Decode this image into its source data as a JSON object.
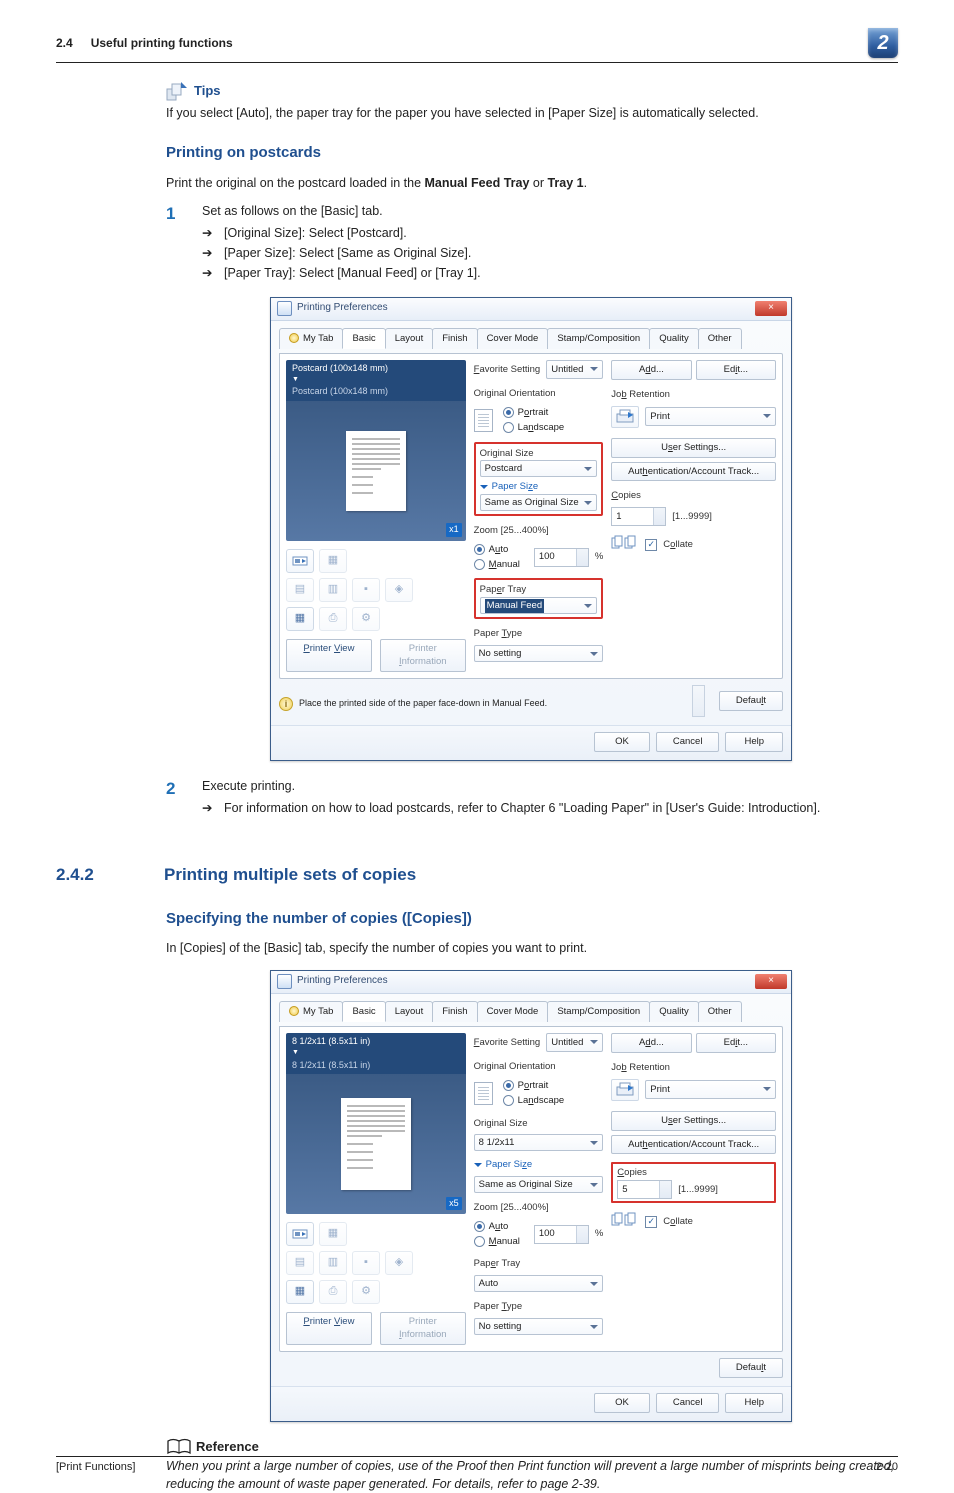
{
  "header": {
    "section": "2.4",
    "title": "Useful printing functions",
    "chapter": "2"
  },
  "tips": {
    "label": "Tips",
    "body": "If you select [Auto], the paper tray for the paper you have selected in [Paper Size] is automatically selected."
  },
  "postcards": {
    "heading": "Printing on postcards",
    "intro_pre": "Print the original on the postcard loaded in the ",
    "intro_b1": "Manual Feed Tray",
    "intro_mid": " or ",
    "intro_b2": "Tray 1",
    "intro_post": ".",
    "step1": {
      "num": "1",
      "text": "Set as follows on the [Basic] tab.",
      "bullets": [
        "[Original Size]: Select [Postcard].",
        "[Paper Size]: Select [Same as Original Size].",
        "[Paper Tray]: Select [Manual Feed] or [Tray 1]."
      ]
    },
    "step2": {
      "num": "2",
      "text": "Execute printing.",
      "bullets": [
        "For information on how to load postcards, refer to Chapter 6 \"Loading Paper\" in [User's Guide: Introduction]."
      ]
    }
  },
  "section242": {
    "num": "2.4.2",
    "title": "Printing multiple sets of copies",
    "sub": "Specifying the number of copies ([Copies])",
    "intro": "In [Copies] of the [Basic] tab, specify the number of copies you want to print."
  },
  "reference": {
    "label": "Reference",
    "body": "When you print a large number of copies, use of the Proof then Print function will prevent a large number of misprints being created, reducing the amount of waste paper generated. For details, refer to page 2-39."
  },
  "dialog": {
    "title": "Printing Preferences",
    "close": "×",
    "tabs": {
      "mytab": "My Tab",
      "basic": "Basic",
      "layout": "Layout",
      "finish": "Finish",
      "cover": "Cover Mode",
      "stamp": "Stamp/Composition",
      "quality": "Quality",
      "other": "Other"
    },
    "preview1": {
      "line1": "Postcard (100x148 mm)",
      "line2": "Postcard (100x148 mm)",
      "badge": "x1"
    },
    "preview2": {
      "line1": "8 1/2x11 (8.5x11 in)",
      "line2": "8 1/2x11 (8.5x11 in)",
      "badge": "x5"
    },
    "printer_view": "Printer View",
    "printer_info": "Printer Information",
    "favorite": {
      "label": "Favorite Setting",
      "value": "Untitled"
    },
    "add": "Add...",
    "edit": "Edit...",
    "orientation": {
      "label": "Original Orientation",
      "portrait": "Portrait",
      "landscape": "Landscape"
    },
    "orig_size": {
      "label": "Original Size",
      "v1": "Postcard",
      "v2": "8 1/2x11"
    },
    "paper_size": {
      "label": "Paper Size",
      "value": "Same as Original Size"
    },
    "zoom": {
      "label": "Zoom [25...400%]",
      "auto": "Auto",
      "manual": "Manual",
      "value": "100",
      "pct": "%"
    },
    "paper_tray": {
      "label": "Paper Tray",
      "v1": "Manual Feed",
      "v2": "Auto"
    },
    "paper_type": {
      "label": "Paper Type",
      "value": "No setting"
    },
    "job_ret": {
      "label": "Job Retention",
      "value": "Print"
    },
    "user_settings": "User Settings...",
    "auth": "Authentication/Account Track...",
    "copies": {
      "label": "Copies",
      "v1": "1",
      "v2": "5",
      "range": "[1...9999]"
    },
    "collate": "Collate",
    "bottom_note": "Place the printed side of the paper face-down in Manual Feed.",
    "default": "Default",
    "ok": "OK",
    "cancel": "Cancel",
    "help": "Help"
  },
  "footer": {
    "left": "[Print Functions]",
    "right": "2-20"
  },
  "arrow_glyph": "➔"
}
